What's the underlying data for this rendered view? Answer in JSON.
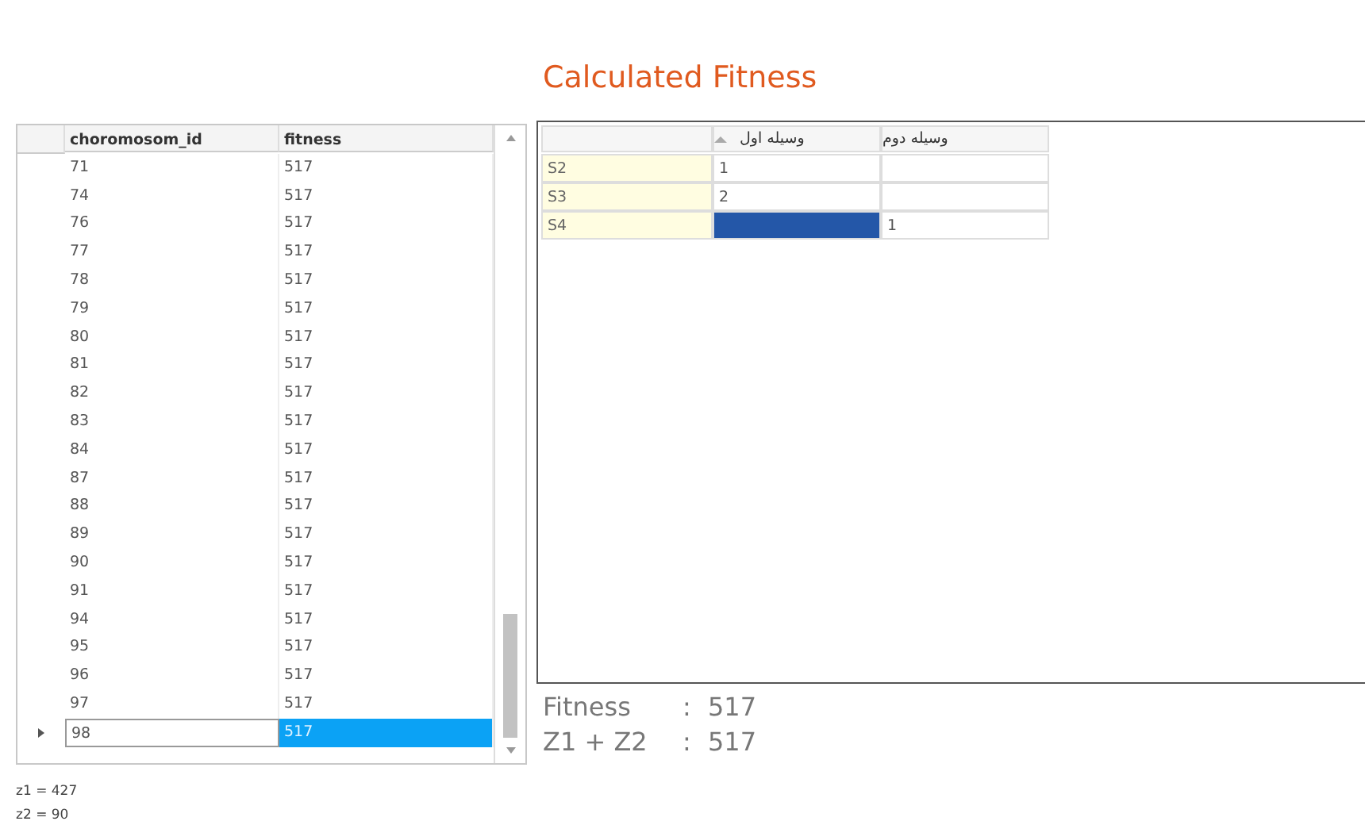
{
  "title": "Calculated Fitness",
  "chromosome_grid": {
    "columns": [
      "choromosom_id",
      "fitness"
    ],
    "rows": [
      {
        "id": "71",
        "fitness": "517",
        "selected": false
      },
      {
        "id": "74",
        "fitness": "517",
        "selected": false
      },
      {
        "id": "76",
        "fitness": "517",
        "selected": false
      },
      {
        "id": "77",
        "fitness": "517",
        "selected": false
      },
      {
        "id": "78",
        "fitness": "517",
        "selected": false
      },
      {
        "id": "79",
        "fitness": "517",
        "selected": false
      },
      {
        "id": "80",
        "fitness": "517",
        "selected": false
      },
      {
        "id": "81",
        "fitness": "517",
        "selected": false
      },
      {
        "id": "82",
        "fitness": "517",
        "selected": false
      },
      {
        "id": "83",
        "fitness": "517",
        "selected": false
      },
      {
        "id": "84",
        "fitness": "517",
        "selected": false
      },
      {
        "id": "87",
        "fitness": "517",
        "selected": false
      },
      {
        "id": "88",
        "fitness": "517",
        "selected": false
      },
      {
        "id": "89",
        "fitness": "517",
        "selected": false
      },
      {
        "id": "90",
        "fitness": "517",
        "selected": false
      },
      {
        "id": "91",
        "fitness": "517",
        "selected": false
      },
      {
        "id": "94",
        "fitness": "517",
        "selected": false
      },
      {
        "id": "95",
        "fitness": "517",
        "selected": false
      },
      {
        "id": "96",
        "fitness": "517",
        "selected": false
      },
      {
        "id": "97",
        "fitness": "517",
        "selected": false
      },
      {
        "id": "98",
        "fitness": "517",
        "selected": true
      }
    ]
  },
  "assignment_grid": {
    "columns": [
      "وسیله اول",
      "وسیله دوم"
    ],
    "rows": [
      {
        "header": "S2",
        "cells": [
          {
            "value": "1",
            "selected": false
          },
          {
            "selected": false
          }
        ]
      },
      {
        "header": "S3",
        "cells": [
          {
            "value": "2",
            "selected": false
          },
          {
            "selected": false
          }
        ]
      },
      {
        "header": "S4",
        "cells": [
          {
            "selected": true
          },
          {
            "value": "1",
            "selected": false
          }
        ]
      }
    ]
  },
  "summary": [
    {
      "label": "Fitness",
      "separator": ":",
      "value": "517"
    },
    {
      "label": "Z1 + Z2",
      "separator": ":",
      "value": "517"
    }
  ],
  "notes": [
    "z1 = 427",
    "z2 = 90"
  ]
}
